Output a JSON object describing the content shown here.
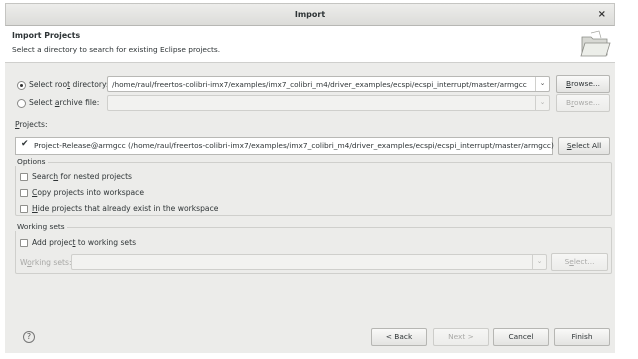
{
  "window": {
    "title": "Import",
    "close_glyph": "×"
  },
  "header": {
    "title": "Import Projects",
    "description": "Select a directory to search for existing Eclipse projects.",
    "icon": "folder-icon"
  },
  "root_directory": {
    "label_pre": "Select roo",
    "label_ul": "t",
    "label_post": " directory:",
    "selected": true,
    "value": "/home/raul/freertos-colibri-imx7/examples/imx7_colibri_m4/driver_examples/ecspi/ecspi_interrupt/master/armgcc",
    "browse_pre": "",
    "browse_ul": "B",
    "browse_post": "rowse..."
  },
  "archive_file": {
    "label_pre": "Select ",
    "label_ul": "a",
    "label_post": "rchive file:",
    "selected": false,
    "value": "",
    "browse_pre": "B",
    "browse_ul": "r",
    "browse_post": "owse..."
  },
  "projects": {
    "label_pre": "",
    "label_ul": "P",
    "label_post": "rojects:",
    "items": [
      {
        "checked": true,
        "label": "Project-Release@armgcc (/home/raul/freertos-colibri-imx7/examples/imx7_colibri_m4/driver_examples/ecspi/ecspi_interrupt/master/armgcc)"
      }
    ],
    "select_all_pre": "",
    "select_all_ul": "S",
    "select_all_post": "elect All"
  },
  "options": {
    "legend": "Options",
    "search_nested": {
      "pre": "Searc",
      "ul": "h",
      "post": " for nested projects",
      "checked": false
    },
    "copy_projects": {
      "pre": "",
      "ul": "C",
      "post": "opy projects into workspace",
      "checked": false
    },
    "hide_projects": {
      "pre": "",
      "ul": "H",
      "post": "ide projects that already exist in the workspace",
      "checked": false
    }
  },
  "working_sets": {
    "legend": "Working sets",
    "add_to": {
      "pre": "Add projec",
      "ul": "t",
      "post": " to working sets",
      "checked": false
    },
    "label_pre": "W",
    "label_ul": "o",
    "label_post": "rking sets:",
    "value": "",
    "select_pre": "S",
    "select_ul": "e",
    "select_post": "lect..."
  },
  "footer": {
    "help_glyph": "?",
    "back": "< Back",
    "next": "Next >",
    "cancel": "Cancel",
    "finish": "Finish"
  },
  "colors": {
    "panel": "#ececea",
    "border": "#b8b8b5",
    "text": "#2e3436"
  }
}
